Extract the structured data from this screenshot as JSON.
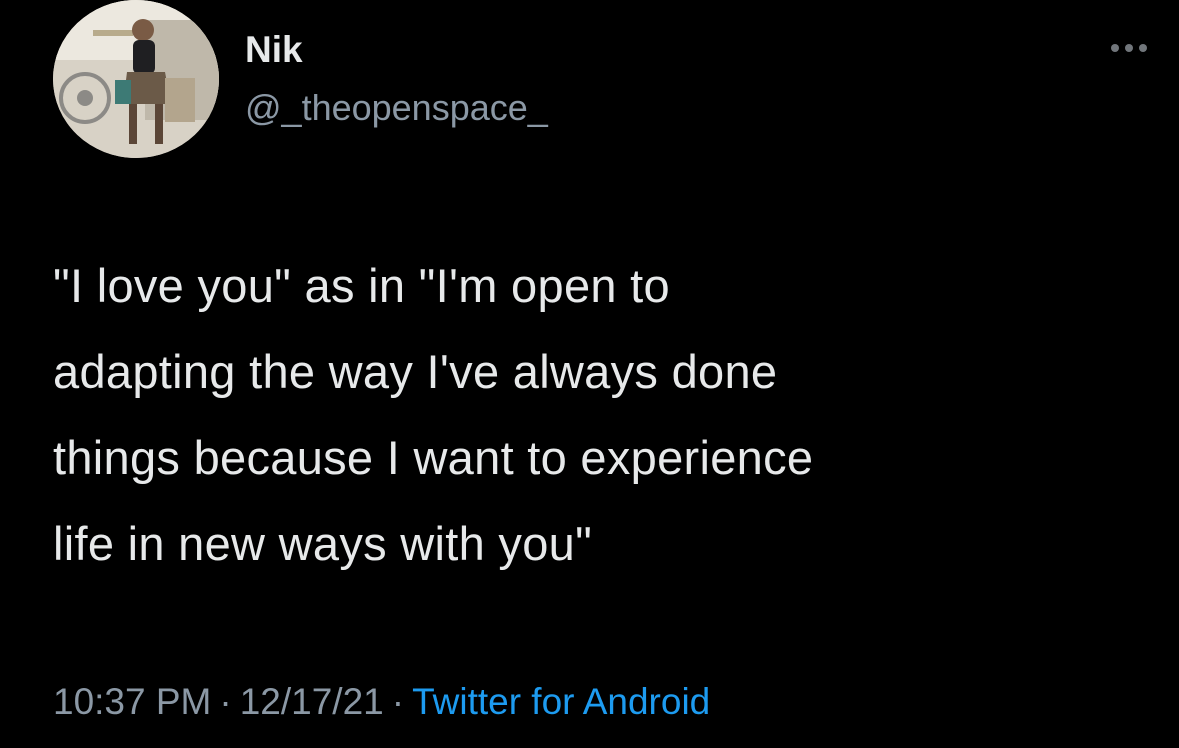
{
  "author": {
    "display_name": "Nik",
    "handle": "@_theopenspace_"
  },
  "tweet": {
    "lines": [
      "\"I love you\" as in \"I'm open to",
      "adapting the way I've always done",
      "things because I want to experience",
      "life in new ways with you\""
    ]
  },
  "meta": {
    "time": "10:37 PM",
    "separator": "·",
    "date": "12/17/21",
    "source": "Twitter for Android"
  },
  "colors": {
    "background": "#000000",
    "text": "#e7e9ea",
    "muted": "#8b98a5",
    "link": "#1d9bf0"
  },
  "icons": {
    "more": "more-dots-icon"
  }
}
